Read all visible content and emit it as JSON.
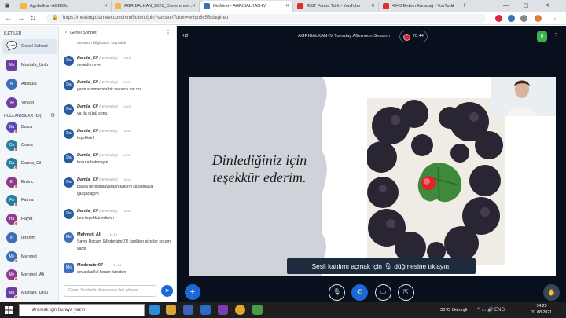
{
  "browser": {
    "tabs": [
      {
        "label": "Agribalkan-AGBIOL",
        "fav": "#f6b73c"
      },
      {
        "label": "AGRIBALKAN_2021_Conference...",
        "fav": "#f6b73c"
      },
      {
        "label": "DiaMeet - AGRIBALKAN-IV",
        "fav": "#3b6fb6"
      },
      {
        "label": "4587 Fatma Türk - YouTube",
        "fav": "#e52d27"
      },
      {
        "label": "4643 Erdem Karadağ - YouTube",
        "fav": "#e52d27"
      }
    ],
    "url": "https://meeting.diameet.com/html5client/join?sessionToken=w9gn6c55cbtqkreo"
  },
  "sidebar": {
    "messages_header": "İLETİLER",
    "public_chat": "Genel Sohbet",
    "pinned_users": [
      {
        "initials": "Mu",
        "name": "Mustafa_Unlu",
        "color": "#6b3fa0"
      },
      {
        "initials": "Ai",
        "name": "Aibibula",
        "color": "#3b6fb6"
      },
      {
        "initials": "Ve",
        "name": "Veysel",
        "color": "#6b3fa0"
      }
    ],
    "users_header": "KULLANICILAR (19)",
    "users": [
      {
        "initials": "Bu",
        "name": "Burcu",
        "color": "#5d4bb5"
      },
      {
        "initials": "Cu",
        "name": "Cuma",
        "color": "#2a7f9f"
      },
      {
        "initials": "Da",
        "name": "Damla_Cil",
        "color": "#2a7f9f"
      },
      {
        "initials": "Er",
        "name": "Erdinc",
        "color": "#8e3b8e"
      },
      {
        "initials": "Fa",
        "name": "Fatma",
        "color": "#2a7f9f"
      },
      {
        "initials": "Ha",
        "name": "Hayat",
        "color": "#8e3b8e"
      },
      {
        "initials": "Ib",
        "name": "Ibrahim",
        "color": "#3b6fb6"
      },
      {
        "initials": "Me",
        "name": "Mehmet",
        "color": "#3b6fb6"
      },
      {
        "initials": "Me",
        "name": "Mehmet_Ali",
        "color": "#8e3b8e"
      },
      {
        "initials": "Mu",
        "name": "Mustafa_Unlu",
        "color": "#6b3fa0"
      }
    ]
  },
  "chat": {
    "title": "Genel Sohbet",
    "top_text": "sorunun bilgisayar kaynaklı",
    "messages": [
      {
        "initials": "Da",
        "name": "Damla_Cil",
        "sub": "(çevrimdışı)",
        "time": "14:09",
        "text": "denedim evet"
      },
      {
        "initials": "Da",
        "name": "Damla_Cil",
        "sub": "(çevrimdışı)",
        "time": "14:09",
        "text": "yarın sunmamda bir sakınca var mı"
      },
      {
        "initials": "Da",
        "name": "Damla_Cil",
        "sub": "(çevrimdışı)",
        "time": "14:09",
        "text": "ya da günü sonu"
      },
      {
        "initials": "Da",
        "name": "Damla_Cil",
        "sub": "(çevrimdışı)",
        "time": "14:10",
        "text": "teşekkürlr"
      },
      {
        "initials": "Da",
        "name": "Damla_Cil",
        "sub": "(çevrimdışı)",
        "time": "14:10",
        "text": "kusura bakmayın"
      },
      {
        "initials": "Da",
        "name": "Damla_Cil",
        "sub": "(çevrimdışı)",
        "time": "14:10",
        "text": "başka bir bilgisayardan katılım sağlamaya çalışacağım"
      },
      {
        "initials": "Da",
        "name": "Damla_Cil",
        "sub": "(çevrimdışı)",
        "time": "14:10",
        "text": "ben teşekkür ederim"
      },
      {
        "initials": "Me",
        "name": "Mehmet_Ali",
        "sub": "",
        "time": "14:13",
        "text": "Sayın Hocam (Moderator07) özelden size bir sorum vardı"
      },
      {
        "initials": "Mo",
        "name": "Moderator07",
        "sub": "",
        "time": "14:14",
        "text": "cevapladık Hocam özelden"
      }
    ],
    "input_placeholder": "Genel Sohbet kullanıcısına ileti gönder"
  },
  "meeting": {
    "title": "AGRIBALKAN-IV Tuesday Afternoon Session",
    "rec_time": "70:44",
    "slide_text": "Dinlediğiniz için teşekkür ederim.",
    "notification": "Sesli katılımı açmak için 🎙 düğmesine tıklayın."
  },
  "taskbar": {
    "search_placeholder": "Aramak için buraya yazın",
    "weather": "30°C  Güneşli",
    "time": "14:25",
    "date": "31.08.2021"
  }
}
